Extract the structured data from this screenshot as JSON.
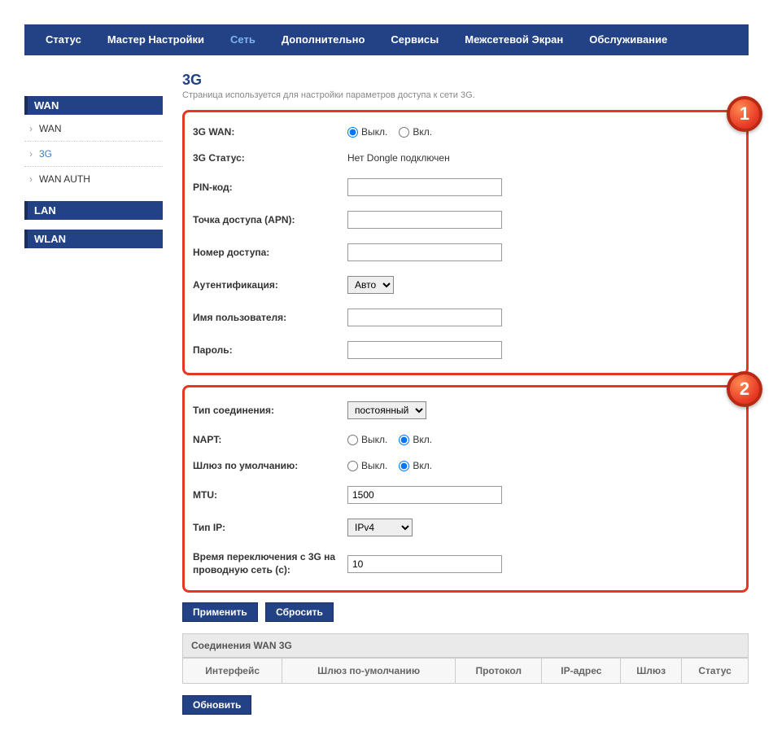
{
  "nav": {
    "items": [
      "Статус",
      "Мастер Настройки",
      "Сеть",
      "Дополнительно",
      "Сервисы",
      "Межсетевой Экран",
      "Обслуживание"
    ],
    "active_index": 2
  },
  "sidebar": {
    "groups": [
      {
        "title": "WAN",
        "items": [
          {
            "label": "WAN",
            "sel": false
          },
          {
            "label": "3G",
            "sel": true
          },
          {
            "label": "WAN AUTH",
            "sel": false
          }
        ]
      },
      {
        "title": "LAN",
        "items": []
      },
      {
        "title": "WLAN",
        "items": []
      }
    ]
  },
  "page": {
    "title": "3G",
    "subtitle": "Страница используется для настройки параметров доступа к сети 3G."
  },
  "badges": {
    "one": "1",
    "two": "2"
  },
  "form1": {
    "wan_label": "3G WAN:",
    "wan_off": "Выкл.",
    "wan_on": "Вкл.",
    "wan_value": "off",
    "status_label": "3G Статус:",
    "status_value": "Нет Dongle подключен",
    "pin_label": "PIN-код:",
    "pin_value": "",
    "apn_label": "Точка доступа (APN):",
    "apn_value": "",
    "dial_label": "Номер доступа:",
    "dial_value": "",
    "auth_label": "Аутентификация:",
    "auth_value": "Авто",
    "user_label": "Имя пользователя:",
    "user_value": "",
    "pass_label": "Пароль:",
    "pass_value": ""
  },
  "form2": {
    "conn_label": "Тип соединения:",
    "conn_value": "постоянный",
    "napt_label": "NAPT:",
    "napt_off": "Выкл.",
    "napt_on": "Вкл.",
    "napt_value": "on",
    "gw_label": "Шлюз по умолчанию:",
    "gw_off": "Выкл.",
    "gw_on": "Вкл.",
    "gw_value": "on",
    "mtu_label": "MTU:",
    "mtu_value": "1500",
    "iptype_label": "Тип IP:",
    "iptype_value": "IPv4",
    "switch_label": "Время переключения с 3G на проводную сеть (с):",
    "switch_value": "10"
  },
  "buttons": {
    "apply": "Применить",
    "reset": "Сбросить",
    "refresh": "Обновить"
  },
  "table": {
    "title": "Соединения WAN 3G",
    "cols": [
      "Интерфейс",
      "Шлюз по-умолчанию",
      "Протокол",
      "IP-адрес",
      "Шлюз",
      "Статус"
    ]
  }
}
